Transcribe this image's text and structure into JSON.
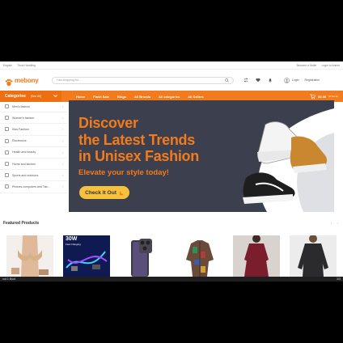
{
  "topbar": {
    "left": [
      "English",
      "Thuis Handling"
    ],
    "right": [
      "Become a Seller",
      "Login to Admin"
    ]
  },
  "brand": {
    "name": "mebony",
    "color": "#f27b1e"
  },
  "search": {
    "placeholder": "I am shopping for..."
  },
  "account": {
    "login": "Login",
    "register": "Registration"
  },
  "nav": {
    "categories_label": "Categories",
    "see_all": "(See All)",
    "menu": [
      "Home",
      "Flash Sale",
      "Blogs",
      "All Brands",
      "All categories",
      "All Sellers"
    ],
    "cart_amount": "$0.00",
    "cart_items": "(0 Items)"
  },
  "categories": [
    "Men's fashion",
    "Women's fashion",
    "Kids Fashion",
    "Electronics",
    "Health and beauty",
    "Home and kitchen",
    "Sports and outdoors",
    "Phones,computers and Tab..."
  ],
  "banner": {
    "line1": "Discover",
    "line2": "the Latest Trends",
    "line3": "in Unisex Fashion",
    "subtitle": "Elevate your style today!",
    "cta": "Check It Out",
    "bg": "#3c3f4d",
    "accent": "#f27b1e",
    "cta_color": "#f6c23e"
  },
  "featured": {
    "title": "Featured Products",
    "items": [
      {
        "icon": "bra-product-image"
      },
      {
        "icon": "cable-product-image",
        "label": "30W",
        "sublabel": "Fast Charging"
      },
      {
        "icon": "phone-product-image"
      },
      {
        "icon": "shirt-product-image"
      },
      {
        "icon": "dress-product-image"
      },
      {
        "icon": "sweater-product-image"
      }
    ]
  },
  "dock": {
    "left": "oot 1 Bout",
    "right": "3/3"
  }
}
